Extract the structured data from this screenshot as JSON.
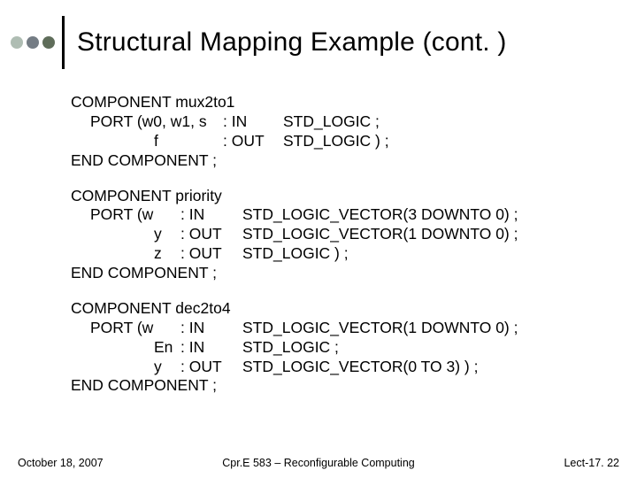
{
  "title": "Structural Mapping Example (cont. )",
  "block1": {
    "l1": "COMPONENT mux2to1",
    "l2_a": "PORT (w0, w1, s",
    "l2_b": ": IN",
    "l2_c": "STD_LOGIC ;",
    "l3_a": "f",
    "l3_b": ": OUT",
    "l3_c": "STD_LOGIC ) ;",
    "l4": "END COMPONENT ;"
  },
  "block2": {
    "l1": "COMPONENT priority",
    "l2_a": "PORT (w",
    "l2_b": ": IN",
    "l2_c": "STD_LOGIC_VECTOR(3 DOWNTO 0) ;",
    "l3_a": "y",
    "l3_b": ": OUT",
    "l3_c": "STD_LOGIC_VECTOR(1 DOWNTO 0) ;",
    "l4_a": "z",
    "l4_b": ": OUT",
    "l4_c": "STD_LOGIC ) ;",
    "l5": "END COMPONENT ;"
  },
  "block3": {
    "l1": "COMPONENT dec2to4",
    "l2_a": "PORT (w",
    "l2_b": ": IN",
    "l2_c": "STD_LOGIC_VECTOR(1 DOWNTO 0) ;",
    "l3_a": "En",
    "l3_b": ": IN",
    "l3_c": "STD_LOGIC ;",
    "l4_a": "y",
    "l4_b": ": OUT",
    "l4_c": "STD_LOGIC_VECTOR(0 TO 3) ) ;",
    "l5": "END COMPONENT ;"
  },
  "footer": {
    "left": "October 18, 2007",
    "center": "Cpr.E 583 – Reconfigurable Computing",
    "right": "Lect-17. 22"
  }
}
